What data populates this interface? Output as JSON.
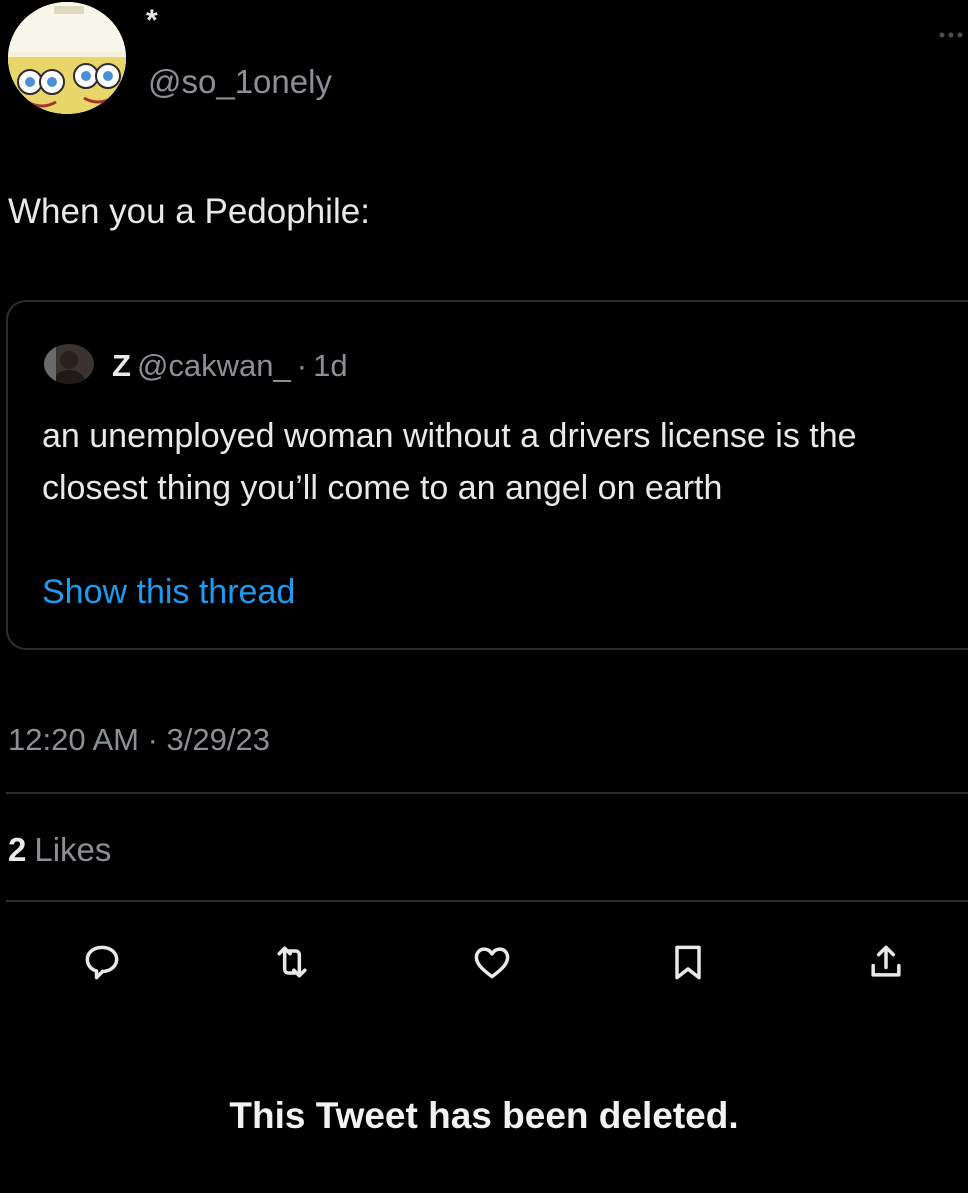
{
  "tweet": {
    "display_name": "*",
    "handle": "@so_1onely",
    "text": "When you a Pedophile:",
    "more_icon": "more-icon",
    "quoted": {
      "name": "Z",
      "handle": "@cakwan_",
      "separator": "·",
      "time": "1d",
      "body": "an unemployed woman without a drivers license is the closest thing you’ll come to an angel on earth",
      "show_thread": "Show this thread"
    },
    "timestamp": "12:20 AM · 3/29/23",
    "likes_count": "2",
    "likes_label": "Likes"
  },
  "actions": [
    {
      "icon": "reply-icon"
    },
    {
      "icon": "retweet-icon"
    },
    {
      "icon": "like-icon"
    },
    {
      "icon": "bookmark-icon"
    },
    {
      "icon": "share-icon"
    }
  ],
  "caption": "This Tweet has been deleted.",
  "colors": {
    "background": "#000000",
    "text_primary": "#e7e9ea",
    "text_secondary": "#8b9096",
    "link": "#1d9bf0",
    "border": "#2a2d31"
  }
}
